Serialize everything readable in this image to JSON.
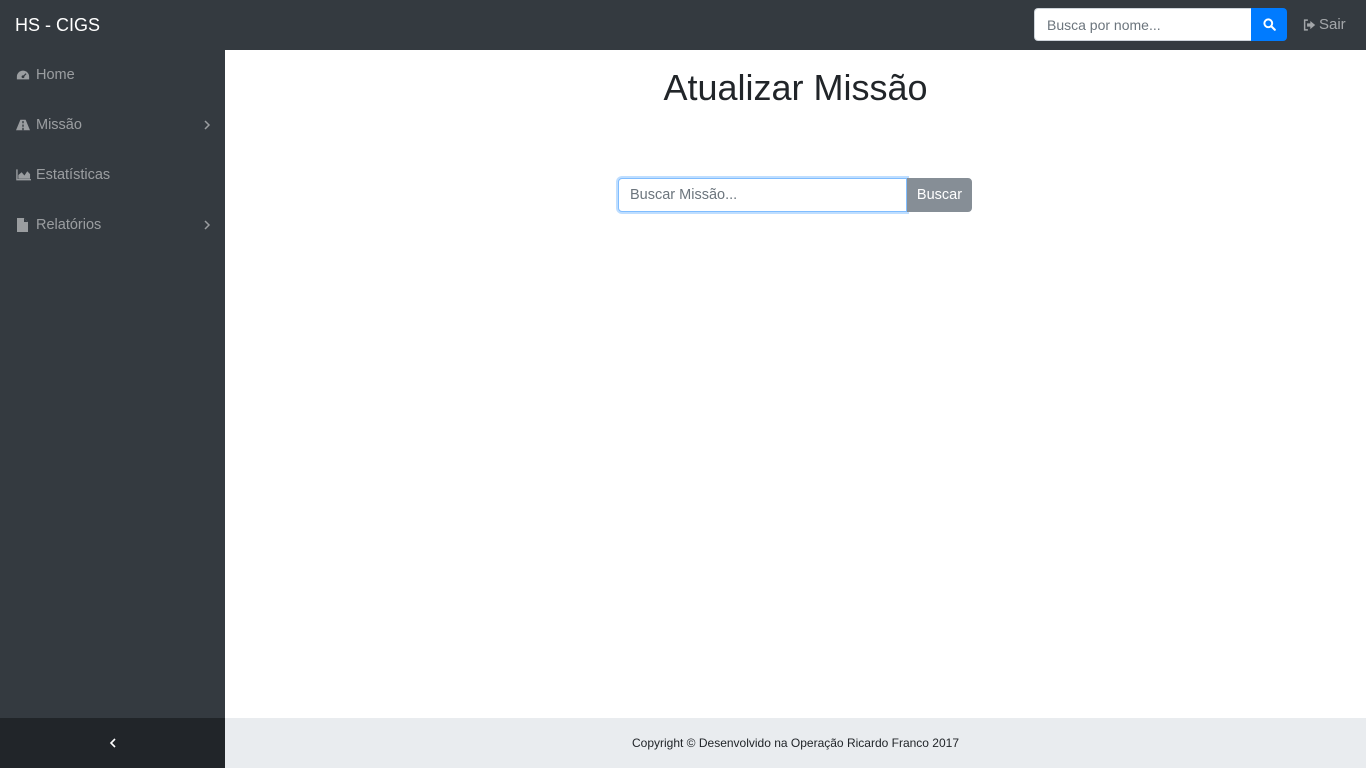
{
  "topbar": {
    "brand": "HS - CIGS",
    "search": {
      "placeholder": "Busca por nome...",
      "icon": "search-icon"
    },
    "logout": {
      "label": "Sair",
      "icon": "sign-out-icon"
    },
    "colors": {
      "bar": "#343a40",
      "search_button": "#007bff"
    }
  },
  "sidebar": {
    "items": [
      {
        "label": "Home",
        "icon": "dashboard-icon",
        "has_submenu": false
      },
      {
        "label": "Missão",
        "icon": "road-icon",
        "has_submenu": true
      },
      {
        "label": "Estatísticas",
        "icon": "area-chart-icon",
        "has_submenu": false
      },
      {
        "label": "Relatórios",
        "icon": "file-icon",
        "has_submenu": true
      }
    ],
    "toggle_icon": "chevron-left-icon"
  },
  "main": {
    "title": "Atualizar Missão",
    "search": {
      "placeholder": "Buscar Missão...",
      "button_label": "Buscar"
    }
  },
  "footer": {
    "text": "Copyright © Desenvolvido na Operação Ricardo Franco 2017"
  }
}
